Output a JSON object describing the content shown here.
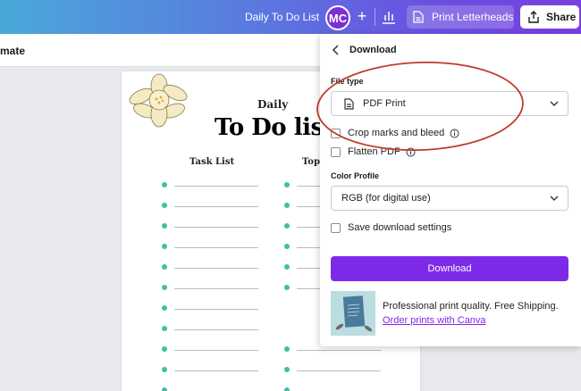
{
  "header": {
    "doc_title": "Daily To Do List",
    "avatar_initials": "MC",
    "plus": "+",
    "print_label": "Print Letterheads",
    "share_label": "Share",
    "brand_color": "#7d2ae8"
  },
  "subbar": {
    "label": "mate"
  },
  "document": {
    "heading_small": "Daily",
    "heading_large": "To Do list",
    "col1_header": "Task List",
    "col2_header": "Top",
    "bullet_color": "#3fbfa5"
  },
  "download_panel": {
    "title": "Download",
    "file_type_label": "File type",
    "file_type_value": "PDF Print",
    "crop_label": "Crop marks and bleed",
    "flatten_label": "Flatten PDF",
    "color_profile_label": "Color Profile",
    "color_profile_value": "RGB (for digital use)",
    "save_settings_label": "Save download settings",
    "download_button": "Download",
    "promo_text": "Professional print quality. Free Shipping.",
    "promo_link": "Order prints with Canva"
  },
  "icons": [
    "chevron-left-icon",
    "document-icon",
    "chevron-down-icon",
    "info-icon",
    "share-upload-icon",
    "bar-chart-icon",
    "plus-icon"
  ]
}
